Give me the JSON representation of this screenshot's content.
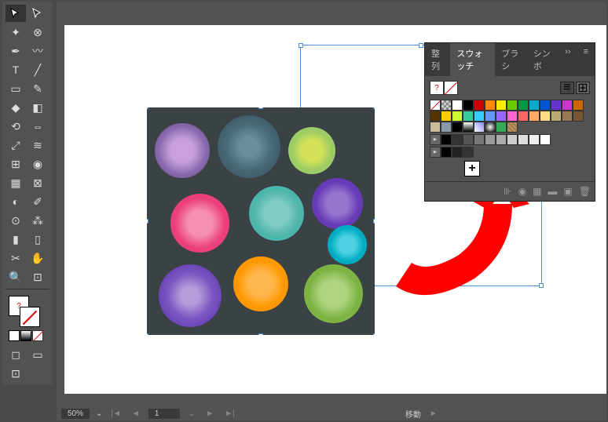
{
  "panel": {
    "tabs": [
      "整列",
      "スウォッチ",
      "ブラシ",
      "シンボ"
    ],
    "active_tab": 1,
    "more": "››",
    "menu": "≡",
    "fill_hint": "?",
    "small_views": [
      "list",
      "grid"
    ],
    "swatches_row1": [
      "none",
      "reg",
      "#ffffff",
      "#000000",
      "#c00",
      "#ff8800",
      "#ffee00",
      "#66cc00",
      "#009944",
      "#00aacc",
      "#0055cc",
      "#6633cc",
      "#cc33cc",
      "#cc6600",
      "#553300"
    ],
    "swatches_row2": [
      "#ffcc00",
      "#ccff33",
      "#33cc99",
      "#33ccff",
      "#6699ff",
      "#9966ff",
      "#ff66cc",
      "#ff6666",
      "#ffaa66",
      "#ffdd88",
      "#bbaa77",
      "#997755",
      "#775533",
      "#ccbb99",
      "#8899aa"
    ],
    "swatches_row3": [
      "#000",
      "#333",
      "#555",
      "#777",
      "#999",
      "#aaa",
      "#ccc",
      "#ddd",
      "#eee",
      "#fff"
    ],
    "swatches_row4": [
      "#000",
      "#222",
      "#333"
    ],
    "footer_icons": [
      "lib",
      "opts",
      "link",
      "new-group",
      "new",
      "delete"
    ]
  },
  "status": {
    "zoom": "50%",
    "page": "1",
    "mode": "移動"
  },
  "tools": {
    "fill_hint": "?"
  }
}
